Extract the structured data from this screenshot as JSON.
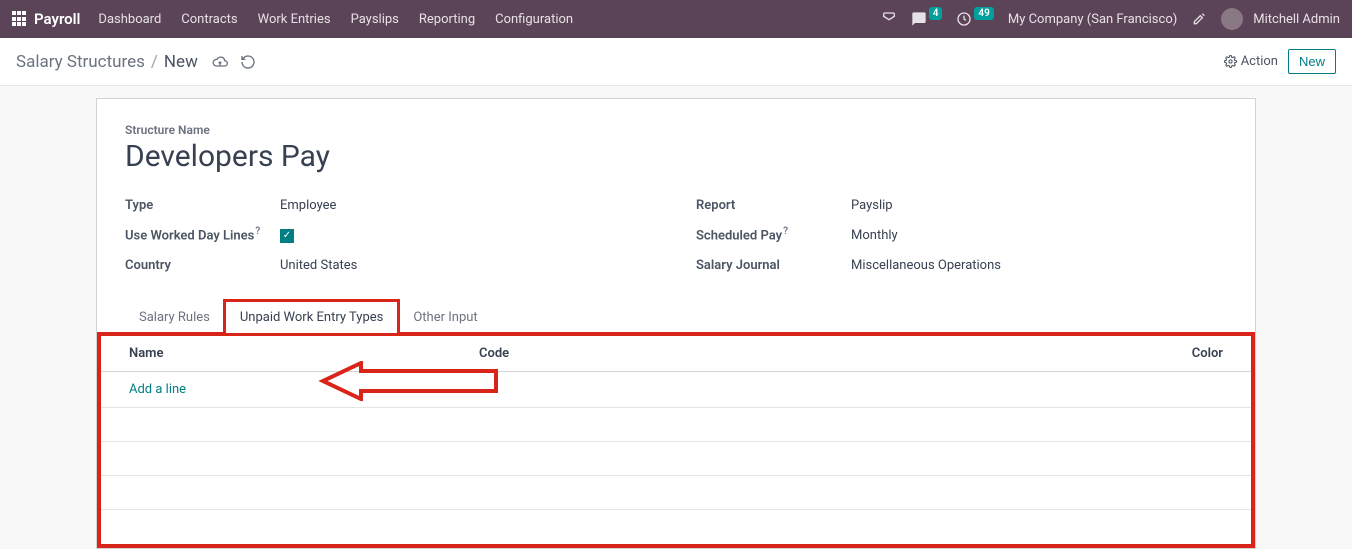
{
  "navbar": {
    "brand": "Payroll",
    "links": [
      "Dashboard",
      "Contracts",
      "Work Entries",
      "Payslips",
      "Reporting",
      "Configuration"
    ],
    "msg_count": "4",
    "clock_count": "49",
    "company": "My Company (San Francisco)",
    "user": "Mitchell Admin"
  },
  "breadcrumb": {
    "parent": "Salary Structures",
    "current": "New"
  },
  "subbar": {
    "action": "Action",
    "new": "New"
  },
  "form": {
    "structure_label": "Structure Name",
    "title": "Developers Pay",
    "left": {
      "type_label": "Type",
      "type_value": "Employee",
      "uwdl_label": "Use Worked Day Lines",
      "country_label": "Country",
      "country_value": "United States"
    },
    "right": {
      "report_label": "Report",
      "report_value": "Payslip",
      "sched_label": "Scheduled Pay",
      "sched_value": "Monthly",
      "journal_label": "Salary Journal",
      "journal_value": "Miscellaneous Operations"
    }
  },
  "tabs": [
    "Salary Rules",
    "Unpaid Work Entry Types",
    "Other Input"
  ],
  "table": {
    "h_name": "Name",
    "h_code": "Code",
    "h_color": "Color",
    "addline": "Add a line"
  }
}
